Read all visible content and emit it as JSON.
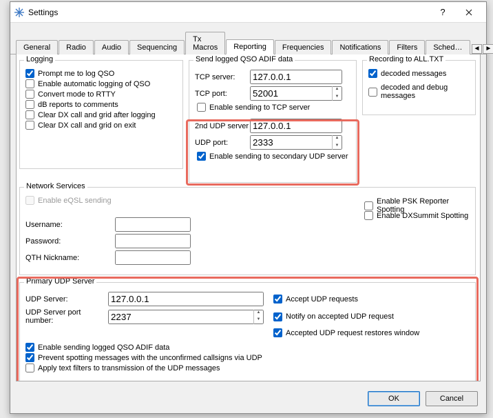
{
  "window": {
    "title": "Settings"
  },
  "tabs": {
    "items": [
      "General",
      "Radio",
      "Audio",
      "Sequencing",
      "Tx Macros",
      "Reporting",
      "Frequencies",
      "Notifications",
      "Filters",
      "Sched…"
    ],
    "active": 5
  },
  "logging": {
    "legend": "Logging",
    "prompt": "Prompt me to log QSO",
    "autolog": "Enable automatic logging of QSO",
    "convert": "Convert mode to RTTY",
    "db": "dB reports to comments",
    "clear_after": "Clear DX call and grid after logging",
    "clear_exit": "Clear DX call and grid on exit"
  },
  "adif": {
    "legend": "Send logged QSO ADIF data",
    "tcp_server_lab": "TCP server:",
    "tcp_server": "127.0.0.1",
    "tcp_port_lab": "TCP port:",
    "tcp_port": "52001",
    "enable_tcp": "Enable sending to TCP server",
    "udp2_server_lab": "2nd UDP server",
    "udp2_server": "127.0.0.1",
    "udp2_port_lab": "UDP port:",
    "udp2_port": "2333",
    "enable_udp2": "Enable sending to secondary UDP server"
  },
  "recording": {
    "legend": "Recording to ALL.TXT",
    "decoded": "decoded messages",
    "debug": "decoded and debug messages"
  },
  "network": {
    "legend": "Network Services",
    "eqsl": "Enable eQSL sending",
    "psk": "Enable PSK Reporter Spotting",
    "dxs": "Enable DXSummit Spotting",
    "user_lab": "Username:",
    "pass_lab": "Password:",
    "qth_lab": "QTH Nickname:"
  },
  "primary": {
    "legend": "Primary UDP Server",
    "server_lab": "UDP Server:",
    "server": "127.0.0.1",
    "port_lab": "UDP Server port number:",
    "port": "2237",
    "accept": "Accept UDP requests",
    "notify": "Notify on accepted UDP request",
    "restore": "Accepted UDP request restores window",
    "enable_adif": "Enable sending logged QSO ADIF data",
    "prevent": "Prevent spotting messages with the unconfirmed callsigns via UDP",
    "filters": "Apply text filters to transmission of the UDP messages"
  },
  "buttons": {
    "ok": "OK",
    "cancel": "Cancel"
  }
}
